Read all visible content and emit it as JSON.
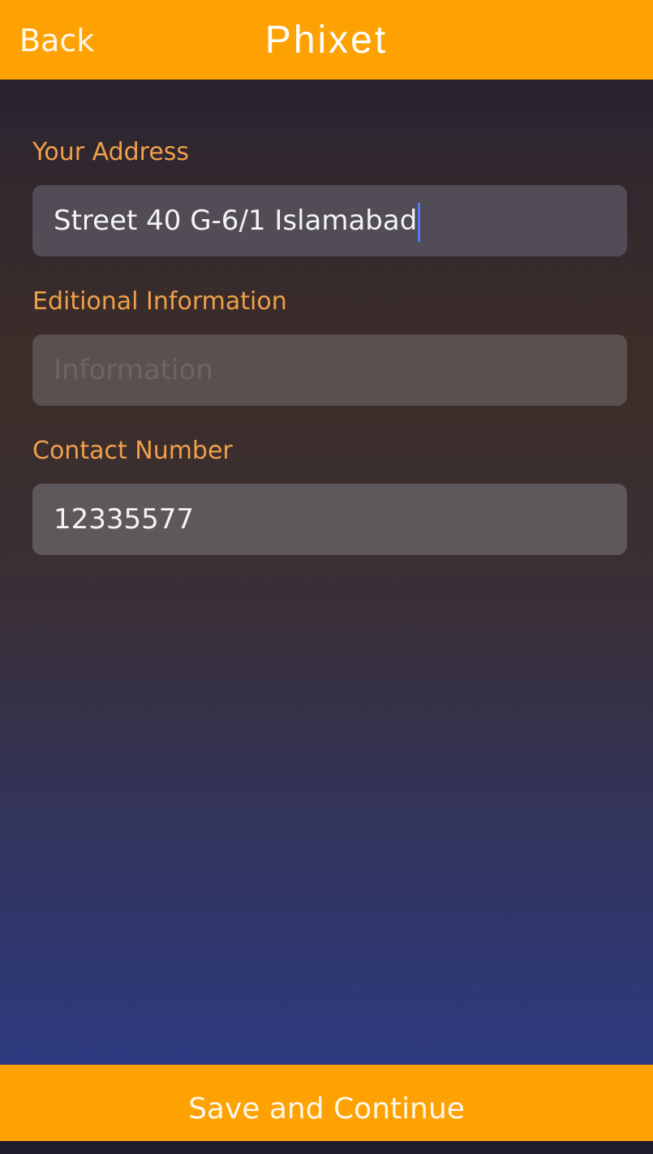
{
  "header": {
    "back_label": "Back",
    "title": "Phixet"
  },
  "form": {
    "address": {
      "label": "Your Address",
      "value": "Street 40 G-6/1 Islamabad"
    },
    "additional": {
      "label": "Editional Information",
      "placeholder": "Information"
    },
    "contact": {
      "label": "Contact Number",
      "value": "12335577"
    }
  },
  "footer": {
    "button_label": "Save and Continue"
  },
  "colors": {
    "accent": "#fea203",
    "label": "#f0a04a",
    "caret": "#4e7dfc"
  }
}
